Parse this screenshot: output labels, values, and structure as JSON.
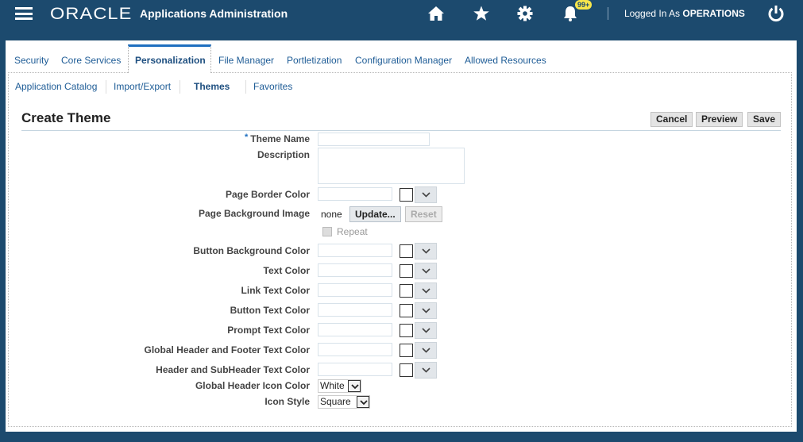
{
  "header": {
    "brand": "ORACLE",
    "app_title": "Applications Administration",
    "notification_count": "99+",
    "logged_in_prefix": "Logged In As",
    "user": "OPERATIONS",
    "icons": [
      "menu-icon",
      "home-icon",
      "star-icon",
      "gear-icon",
      "bell-icon",
      "power-icon"
    ]
  },
  "tabs": [
    {
      "label": "Security",
      "active": false
    },
    {
      "label": "Core Services",
      "active": false
    },
    {
      "label": "Personalization",
      "active": true
    },
    {
      "label": "File Manager",
      "active": false
    },
    {
      "label": "Portletization",
      "active": false
    },
    {
      "label": "Configuration Manager",
      "active": false
    },
    {
      "label": "Allowed Resources",
      "active": false
    }
  ],
  "subtabs": [
    {
      "label": "Application Catalog",
      "active": false
    },
    {
      "label": "Import/Export",
      "active": false
    },
    {
      "label": "Themes",
      "active": true
    },
    {
      "label": "Favorites",
      "active": false
    }
  ],
  "page": {
    "title": "Create Theme",
    "buttons": {
      "cancel": "Cancel",
      "preview": "Preview",
      "save": "Save"
    }
  },
  "form": {
    "required_marker": "*",
    "theme_name": {
      "label": "Theme Name",
      "value": ""
    },
    "description": {
      "label": "Description",
      "value": ""
    },
    "page_border_color": {
      "label": "Page Border Color",
      "value": ""
    },
    "page_background_image": {
      "label": "Page Background Image",
      "value": "none",
      "update_label": "Update...",
      "reset_label": "Reset"
    },
    "repeat": {
      "label": "Repeat",
      "checked": false,
      "disabled": true
    },
    "color_fields": [
      {
        "label": "Button Background Color",
        "value": ""
      },
      {
        "label": "Text Color",
        "value": ""
      },
      {
        "label": "Link Text Color",
        "value": ""
      },
      {
        "label": "Button Text Color",
        "value": ""
      },
      {
        "label": "Prompt Text Color",
        "value": ""
      },
      {
        "label": "Global Header and Footer Text Color",
        "value": ""
      },
      {
        "label": "Header and SubHeader Text Color",
        "value": ""
      }
    ],
    "global_header_icon_color": {
      "label": "Global Header Icon Color",
      "value": "White"
    },
    "icon_style": {
      "label": "Icon Style",
      "value": "Square"
    }
  }
}
